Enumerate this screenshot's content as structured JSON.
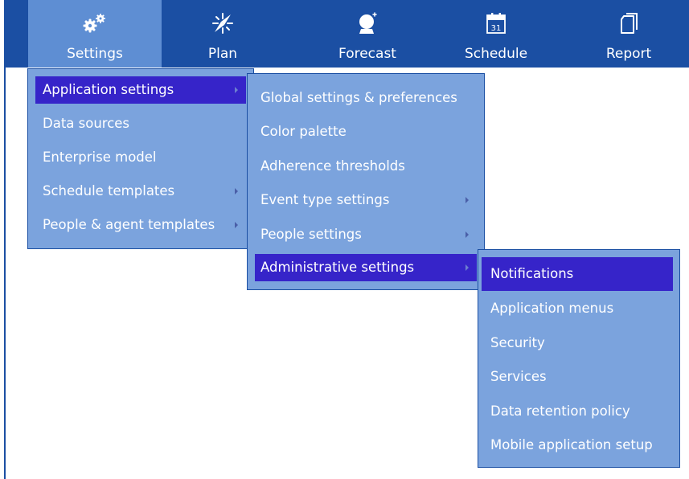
{
  "nav": {
    "items": [
      {
        "label": "Settings",
        "icon": "gears-icon",
        "active": true
      },
      {
        "label": "Plan",
        "icon": "compass-icon",
        "active": false
      },
      {
        "label": "Forecast",
        "icon": "crystal-ball-icon",
        "active": false
      },
      {
        "label": "Schedule",
        "icon": "calendar-icon",
        "calendar_day": "31",
        "active": false
      },
      {
        "label": "Report",
        "icon": "report-pages-icon",
        "active": false
      }
    ]
  },
  "settings_menu": {
    "items": [
      {
        "label": "Application settings",
        "has_submenu": true,
        "highlighted": true
      },
      {
        "label": "Data sources",
        "has_submenu": false
      },
      {
        "label": "Enterprise model",
        "has_submenu": false
      },
      {
        "label": "Schedule templates",
        "has_submenu": true
      },
      {
        "label": "People & agent templates",
        "has_submenu": true
      }
    ]
  },
  "application_settings_menu": {
    "items": [
      {
        "label": "Global settings & preferences",
        "has_submenu": false
      },
      {
        "label": "Color palette",
        "has_submenu": false
      },
      {
        "label": "Adherence thresholds",
        "has_submenu": false
      },
      {
        "label": "Event type settings",
        "has_submenu": true
      },
      {
        "label": "People settings",
        "has_submenu": true
      },
      {
        "label": "Administrative settings",
        "has_submenu": true,
        "highlighted": true
      }
    ]
  },
  "administrative_settings_menu": {
    "items": [
      {
        "label": "Notifications",
        "highlighted": true
      },
      {
        "label": "Application menus"
      },
      {
        "label": "Security"
      },
      {
        "label": "Services"
      },
      {
        "label": "Data retention policy"
      },
      {
        "label": "Mobile application setup"
      }
    ]
  },
  "colors": {
    "topbar": "#1b4fa3",
    "active_nav": "#5e8ed3",
    "menu_bg": "#7ba3dd",
    "highlight": "#3624c9",
    "text": "#ffffff"
  }
}
